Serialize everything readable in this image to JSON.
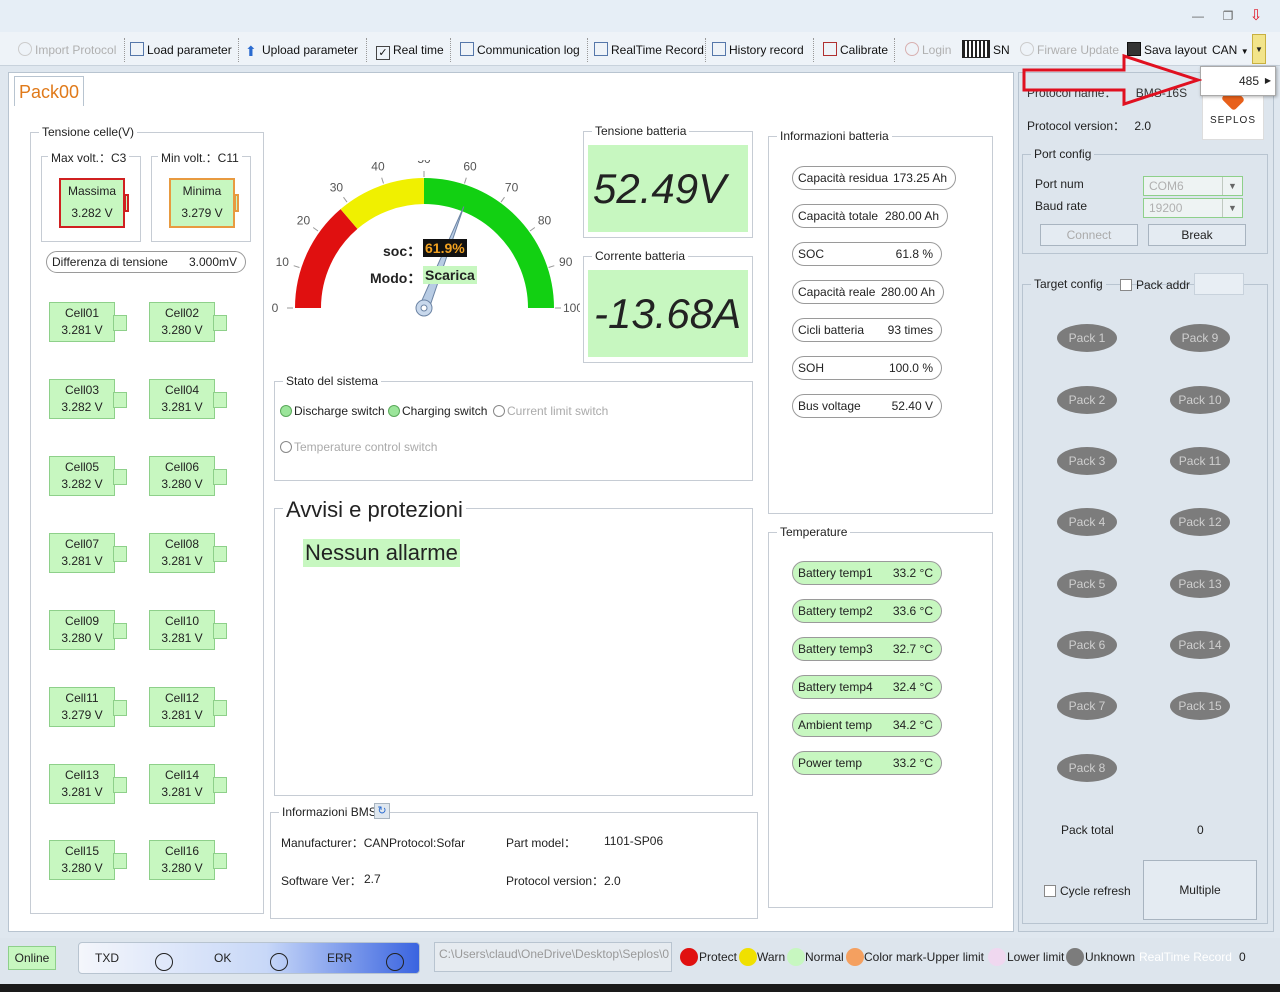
{
  "toolbar": {
    "import_protocol": "Import Protocol",
    "load_parameter": "Load parameter",
    "upload_parameter": "Upload parameter",
    "real_time": "Real time",
    "communication_log": "Communication log",
    "realtime_record": "RealTime Record",
    "history_record": "History record",
    "calibrate": "Calibrate",
    "login": "Login",
    "sn": "SN",
    "firmware_update": "Firware Update",
    "save_layout": "Sava layout",
    "protocol_select": "CAN",
    "dropdown_option": "485"
  },
  "tab": {
    "label": "Pack00"
  },
  "cells_group": {
    "title": "Tensione celle(V)",
    "max_title": "Max volt.：C3",
    "min_title": "Min volt.：C11",
    "max_label": "Massima",
    "max_value": "3.282 V",
    "min_label": "Minima",
    "min_value": "3.279 V",
    "diff_label": "Differenza di tensione",
    "diff_value": "3.000mV",
    "cells": [
      {
        "name": "Cell01",
        "value": "3.281 V"
      },
      {
        "name": "Cell02",
        "value": "3.280 V"
      },
      {
        "name": "Cell03",
        "value": "3.282 V"
      },
      {
        "name": "Cell04",
        "value": "3.281 V"
      },
      {
        "name": "Cell05",
        "value": "3.282 V"
      },
      {
        "name": "Cell06",
        "value": "3.280 V"
      },
      {
        "name": "Cell07",
        "value": "3.281 V"
      },
      {
        "name": "Cell08",
        "value": "3.281 V"
      },
      {
        "name": "Cell09",
        "value": "3.280 V"
      },
      {
        "name": "Cell10",
        "value": "3.281 V"
      },
      {
        "name": "Cell11",
        "value": "3.279 V"
      },
      {
        "name": "Cell12",
        "value": "3.281 V"
      },
      {
        "name": "Cell13",
        "value": "3.281 V"
      },
      {
        "name": "Cell14",
        "value": "3.281 V"
      },
      {
        "name": "Cell15",
        "value": "3.280 V"
      },
      {
        "name": "Cell16",
        "value": "3.280 V"
      }
    ]
  },
  "gauge": {
    "ticks": [
      "0",
      "10",
      "20",
      "30",
      "40",
      "50",
      "60",
      "70",
      "80",
      "90",
      "100"
    ],
    "soc_label": "soc：",
    "soc_value": "61.9%",
    "soc_fraction": 0.619,
    "mode_label": "Modo：",
    "mode_value": "Scarica"
  },
  "voltage": {
    "title": "Tensione batteria",
    "value": "52.49V"
  },
  "current": {
    "title": "Corrente batteria",
    "value": "-13.68A"
  },
  "battery_info": {
    "title": "Informazioni batteria",
    "rows": [
      {
        "label": "Capacità residua",
        "value": "173.25 Ah"
      },
      {
        "label": "Capacità totale",
        "value": "280.00 Ah"
      },
      {
        "label": "SOC",
        "value": "61.8 %"
      },
      {
        "label": "Capacità reale",
        "value": "280.00 Ah"
      },
      {
        "label": "Cicli batteria",
        "value": "93 times"
      },
      {
        "label": "SOH",
        "value": "100.0 %"
      },
      {
        "label": "Bus voltage",
        "value": "52.40 V"
      }
    ]
  },
  "system_state": {
    "title": "Stato del sistema",
    "discharge": "Discharge switch",
    "charging": "Charging switch",
    "current_limit": "Current limit switch",
    "temperature_control": "Temperature control switch"
  },
  "alarms": {
    "title": "Avvisi e protezioni",
    "message": "Nessun allarme"
  },
  "temperatures": {
    "title": "Temperature",
    "rows": [
      {
        "label": "Battery temp1",
        "value": "33.2 °C"
      },
      {
        "label": "Battery temp2",
        "value": "33.6 °C"
      },
      {
        "label": "Battery temp3",
        "value": "32.7 °C"
      },
      {
        "label": "Battery temp4",
        "value": "32.4 °C"
      },
      {
        "label": "Ambient temp",
        "value": "34.2 °C"
      },
      {
        "label": "Power temp",
        "value": "33.2 °C"
      }
    ]
  },
  "bms_info": {
    "title": "Informazioni BMS",
    "manufacturer_label": "Manufacturer：",
    "manufacturer_value": "CANProtocol:Sofar",
    "part_label": "Part model：",
    "part_value": "1101-SP06",
    "software_label": "Software Ver：",
    "software_value": "2.7",
    "protocol_label": "Protocol version：",
    "protocol_value": "2.0"
  },
  "right_panel": {
    "protocol_name_label": "Protocol name：",
    "protocol_name_value": "BMS-16S",
    "protocol_version_label": "Protocol version：",
    "protocol_version_value": "2.0",
    "logo_text": "SEPLOS",
    "port_config_title": "Port config",
    "port_num_label": "Port num",
    "port_num_value": "COM6",
    "baud_rate_label": "Baud rate",
    "baud_rate_value": "19200",
    "connect": "Connect",
    "break": "Break",
    "target_config_title": "Target config",
    "pack_addr_label": "Pack addr",
    "packs": [
      "Pack 1",
      "Pack 9",
      "Pack 2",
      "Pack 10",
      "Pack 3",
      "Pack 11",
      "Pack 4",
      "Pack 12",
      "Pack 5",
      "Pack 13",
      "Pack 6",
      "Pack 14",
      "Pack 7",
      "Pack 15",
      "Pack 8"
    ],
    "pack_total_label": "Pack total",
    "pack_total_value": "0",
    "cycle_refresh": "Cycle refresh",
    "multiple": "Multiple"
  },
  "status_bar": {
    "online": "Online",
    "txd": "TXD",
    "ok": "OK",
    "err": "ERR",
    "path": "C:\\Users\\claud\\OneDrive\\Desktop\\Seplos\\0",
    "legend": [
      {
        "label": "Protect",
        "color": "#e01010"
      },
      {
        "label": "Warn",
        "color": "#f0e000"
      },
      {
        "label": "Normal",
        "color": "#c7f7c0"
      },
      {
        "label": "Color mark-Upper limit",
        "color": "#f4a060"
      },
      {
        "label": "Lower limit",
        "color": "#f0d8f0"
      },
      {
        "label": "Unknown",
        "color": "#7c7c7c"
      }
    ],
    "realtime_record": "RealTime Record",
    "record_count": "0"
  },
  "colors": {
    "accent": "#e07a1a",
    "green": "#c7f7c0",
    "red_arrow": "#e01020"
  }
}
